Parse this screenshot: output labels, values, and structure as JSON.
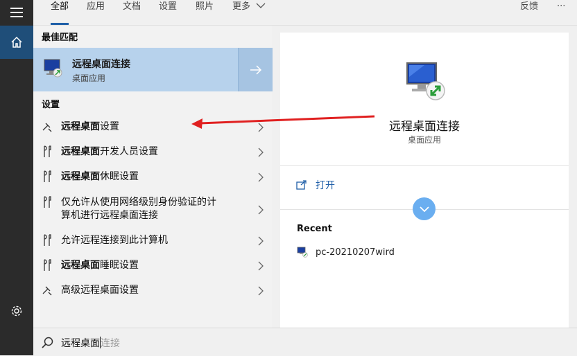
{
  "tabs": [
    {
      "label": "全部",
      "active": true
    },
    {
      "label": "应用"
    },
    {
      "label": "文档"
    },
    {
      "label": "设置"
    },
    {
      "label": "照片"
    },
    {
      "label": "更多"
    }
  ],
  "feedback_label": "反馈",
  "more_options_label": "···",
  "best_match": {
    "header": "最佳匹配",
    "title": "远程桌面连接",
    "subtitle": "桌面应用"
  },
  "settings_section": {
    "header": "设置",
    "items": [
      {
        "bold": "远程桌面",
        "rest": "设置",
        "icon": "remote-settings-icon"
      },
      {
        "bold": "远程桌面",
        "rest": "开发人员设置",
        "icon": "developer-tools-icon"
      },
      {
        "bold": "远程桌面",
        "rest": "休眠设置",
        "icon": "sleep-tools-icon"
      },
      {
        "bold": "",
        "rest": "仅允许从使用网络级别身份验证的计算机进行远程桌面连接",
        "line1": "仅允许从使用网络级别身份验证的计",
        "line2": "算机进行远程桌面连接",
        "icon": "auth-tools-icon"
      },
      {
        "bold": "",
        "rest": "允许远程连接到此计算机",
        "icon": "allow-remote-tools-icon"
      },
      {
        "bold": "远程桌面",
        "rest": "睡眠设置",
        "icon": "sleep2-tools-icon"
      },
      {
        "bold": "",
        "rest": "高级远程桌面设置",
        "icon": "advanced-remote-icon"
      }
    ]
  },
  "detail": {
    "title": "远程桌面连接",
    "subtitle": "桌面应用",
    "open_label": "打开",
    "recent_header": "Recent",
    "recent_items": [
      {
        "label": "pc-20210207wird"
      }
    ]
  },
  "search": {
    "typed": "远程桌面",
    "suggestion": "连接"
  },
  "colors": {
    "accent": "#1f5fa8",
    "selection": "#b7d2ec",
    "annotation_arrow": "#e02020"
  }
}
